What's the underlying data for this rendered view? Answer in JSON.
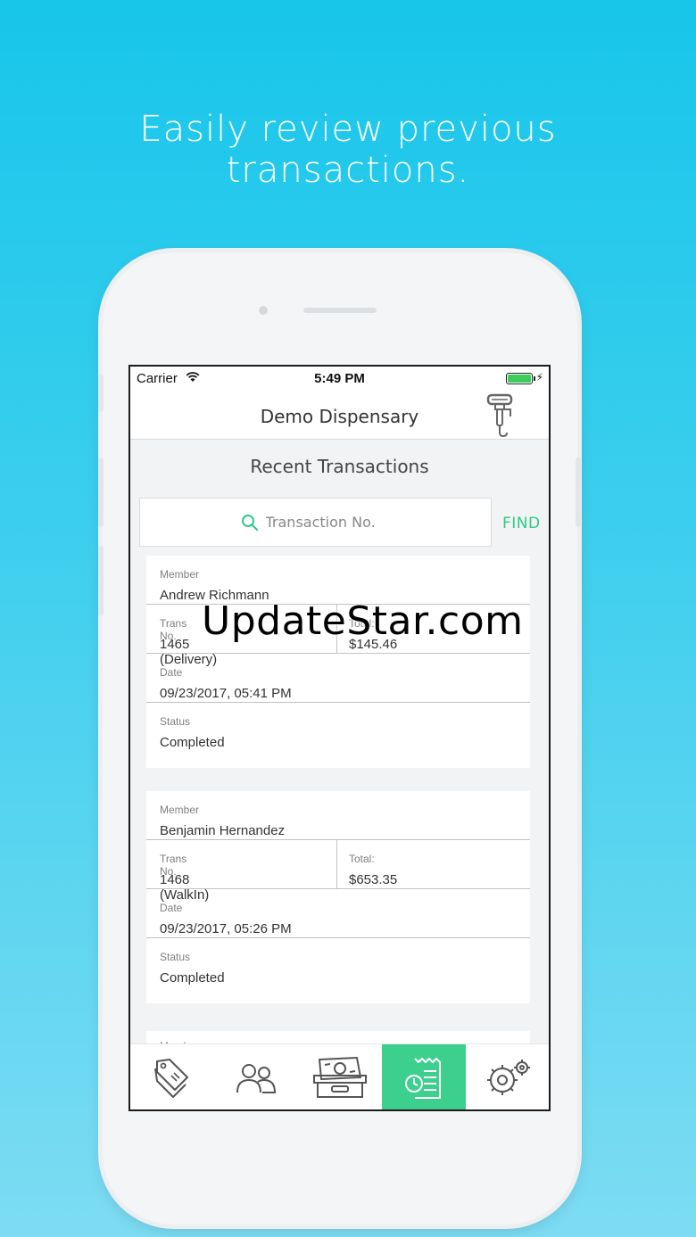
{
  "headline": {
    "line1": "Easily review previous",
    "line2": "transactions."
  },
  "status_bar": {
    "carrier": "Carrier",
    "time": "5:49 PM",
    "battery_percent": 100
  },
  "nav": {
    "title": "Demo Dispensary",
    "scale_icon": "hanging-scale-icon"
  },
  "section_title": "Recent Transactions",
  "search": {
    "placeholder": "Transaction No.",
    "value": "",
    "find_label": "FIND"
  },
  "transactions": [
    {
      "member_label": "Member",
      "member": "Andrew Richmann",
      "trans_label": "Trans No.",
      "trans_no": "1465 (Delivery)",
      "total_label": "Total:",
      "total": "$145.46",
      "date_label": "Date",
      "date": "09/23/2017, 05:41 PM",
      "status_label": "Status",
      "status": "Completed"
    },
    {
      "member_label": "Member",
      "member": "Benjamin Hernandez",
      "trans_label": "Trans No.",
      "trans_no": "1468 (WalkIn)",
      "total_label": "Total:",
      "total": "$653.35",
      "date_label": "Date",
      "date": "09/23/2017, 05:26 PM",
      "status_label": "Status",
      "status": "Completed"
    }
  ],
  "partial_label": "Member",
  "tabs": [
    {
      "name": "tags",
      "icon": "price-tags-icon",
      "active": false
    },
    {
      "name": "members",
      "icon": "people-icon",
      "active": false
    },
    {
      "name": "cash",
      "icon": "cash-drawer-icon",
      "active": false
    },
    {
      "name": "transactions",
      "icon": "receipt-clock-icon",
      "active": true
    },
    {
      "name": "settings",
      "icon": "gears-icon",
      "active": false
    }
  ],
  "colors": {
    "accent": "#3dcf8e",
    "find": "#2dcb86",
    "background_top": "#17c6ea"
  },
  "watermark": "UpdateStar.com"
}
